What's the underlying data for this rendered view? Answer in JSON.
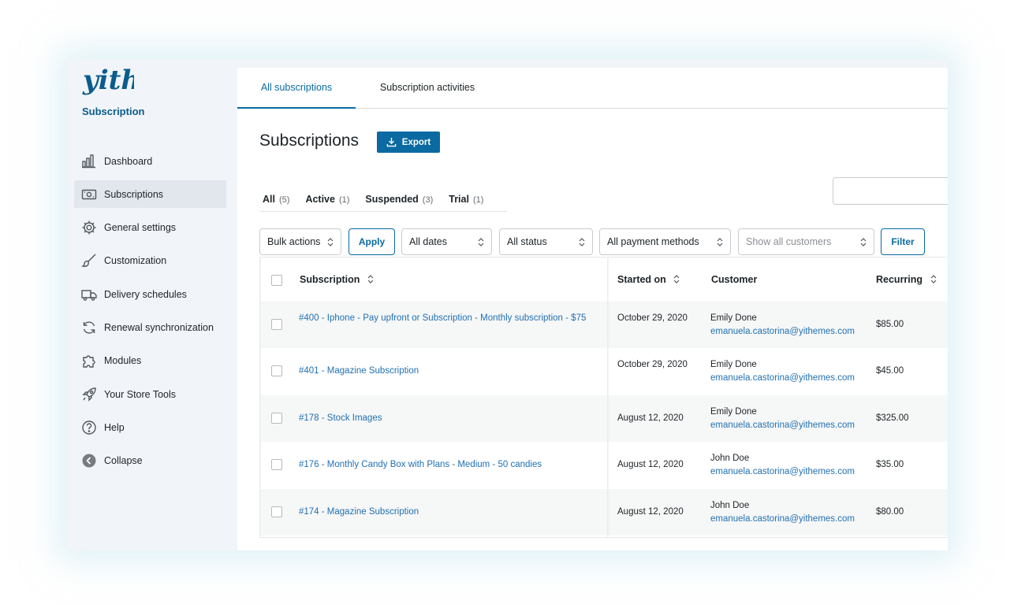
{
  "brand": {
    "logo_text": "yith",
    "subtitle": "Subscription",
    "color": "#0b5c8c"
  },
  "sidebar": {
    "items": [
      {
        "label": "Dashboard",
        "icon": "bar-chart-icon"
      },
      {
        "label": "Subscriptions",
        "icon": "money-icon",
        "active": true
      },
      {
        "label": "General settings",
        "icon": "gear-icon"
      },
      {
        "label": "Customization",
        "icon": "brush-icon"
      },
      {
        "label": "Delivery schedules",
        "icon": "truck-icon"
      },
      {
        "label": "Renewal synchronization",
        "icon": "sync-icon"
      },
      {
        "label": "Modules",
        "icon": "puzzle-icon"
      },
      {
        "label": "Your Store Tools",
        "icon": "rocket-icon"
      },
      {
        "label": "Help",
        "icon": "help-icon"
      },
      {
        "label": "Collapse",
        "icon": "collapse-icon"
      }
    ]
  },
  "tabs": [
    {
      "label": "All subscriptions",
      "active": true
    },
    {
      "label": "Subscription activities",
      "active": false
    }
  ],
  "page": {
    "title": "Subscriptions",
    "export_label": "Export",
    "accent": "#0a6aa1"
  },
  "views": [
    {
      "label": "All",
      "count": "(5)"
    },
    {
      "label": "Active",
      "count": "(1)"
    },
    {
      "label": "Suspended",
      "count": "(3)"
    },
    {
      "label": "Trial",
      "count": "(1)"
    }
  ],
  "filters": {
    "bulk_actions": "Bulk actions",
    "apply": "Apply",
    "dates": "All dates",
    "status": "All status",
    "payment_methods": "All payment methods",
    "customers_placeholder": "Show all customers",
    "filter": "Filter"
  },
  "table": {
    "headers": {
      "subscription": "Subscription",
      "started_on": "Started on",
      "customer": "Customer",
      "recurring": "Recurring"
    },
    "rows": [
      {
        "subscription": "#400 - Iphone - Pay upfront or Subscription - Monthly subscription - $75",
        "started_on": "October 29, 2020",
        "customer_name": "Emily Done",
        "customer_email": "emanuela.castorina@yithemes.com",
        "recurring": "$85.00"
      },
      {
        "subscription": "#401 - Magazine Subscription",
        "started_on": "October 29, 2020",
        "customer_name": "Emily Done",
        "customer_email": "emanuela.castorina@yithemes.com",
        "recurring": "$45.00"
      },
      {
        "subscription": "#178 - Stock Images",
        "started_on": "August 12, 2020",
        "customer_name": "Emily Done",
        "customer_email": "emanuela.castorina@yithemes.com",
        "recurring": "$325.00"
      },
      {
        "subscription": "#176 - Monthly Candy Box with Plans - Medium - 50 candies",
        "started_on": "August 12, 2020",
        "customer_name": "John Doe",
        "customer_email": "emanuela.castorina@yithemes.com",
        "recurring": "$35.00"
      },
      {
        "subscription": "#174 - Magazine Subscription",
        "started_on": "August 12, 2020",
        "customer_name": "John Doe",
        "customer_email": "emanuela.castorina@yithemes.com",
        "recurring": "$80.00"
      }
    ]
  }
}
